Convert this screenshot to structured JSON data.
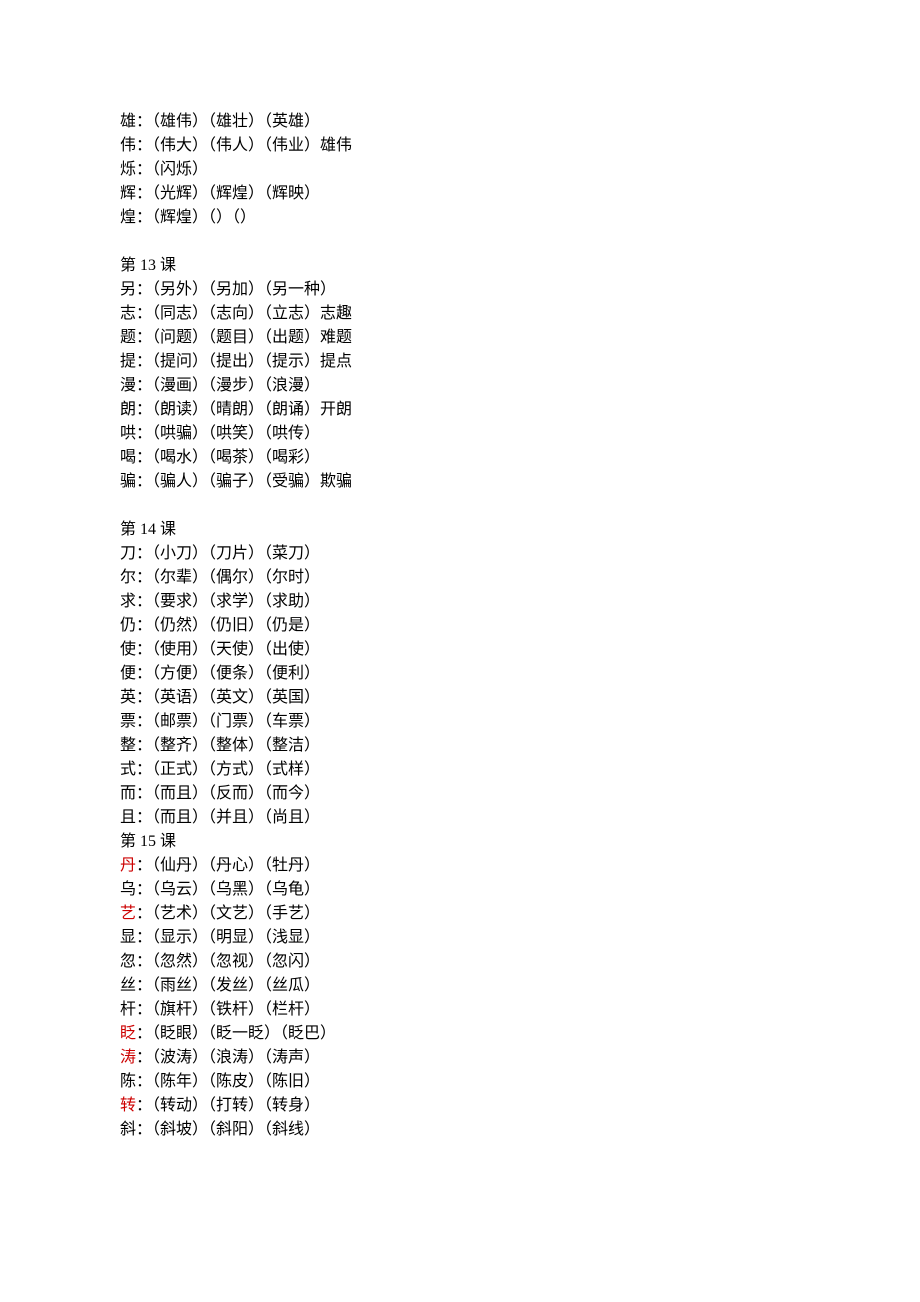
{
  "sections": [
    {
      "header": null,
      "entries": [
        {
          "char": "雄",
          "red": false,
          "words": "（雄伟）（雄壮）（英雄）",
          "extra": ""
        },
        {
          "char": "伟",
          "red": false,
          "words": "（伟大）（伟人）（伟业）",
          "extra": "雄伟"
        },
        {
          "char": "烁",
          "red": false,
          "words": "（闪烁）",
          "extra": ""
        },
        {
          "char": "辉",
          "red": false,
          "words": "（光辉）（辉煌）（辉映）",
          "extra": ""
        },
        {
          "char": "煌",
          "red": false,
          "words": "（辉煌）（）（）",
          "extra": ""
        }
      ]
    },
    {
      "header": "第 13 课",
      "entries": [
        {
          "char": "另",
          "red": false,
          "words": "（另外）（另加）（另一种）",
          "extra": ""
        },
        {
          "char": "志",
          "red": false,
          "words": "（同志）（志向）（立志）",
          "extra": "志趣"
        },
        {
          "char": "题",
          "red": false,
          "words": "（问题）（题目）（出题）",
          "extra": "难题"
        },
        {
          "char": "提",
          "red": false,
          "words": "（提问）（提出）（提示）",
          "extra": "提点"
        },
        {
          "char": "漫",
          "red": false,
          "words": "（漫画）（漫步）（浪漫）",
          "extra": ""
        },
        {
          "char": "朗",
          "red": false,
          "words": "（朗读）（晴朗）（朗诵）",
          "extra": "开朗"
        },
        {
          "char": "哄",
          "red": false,
          "words": "（哄骗）（哄笑）（哄传）",
          "extra": ""
        },
        {
          "char": "喝",
          "red": false,
          "words": "（喝水）（喝茶）（喝彩）",
          "extra": ""
        },
        {
          "char": "骗",
          "red": false,
          "words": "（骗人）（骗子）（受骗）",
          "extra": "欺骗"
        }
      ]
    },
    {
      "header": "第 14 课",
      "entries": [
        {
          "char": "刀",
          "red": false,
          "words": "（小刀）（刀片）（菜刀）",
          "extra": ""
        },
        {
          "char": "尔",
          "red": false,
          "words": "（尔辈）（偶尔）（尔时）",
          "extra": ""
        },
        {
          "char": "求",
          "red": false,
          "words": "（要求）（求学）（求助）",
          "extra": ""
        },
        {
          "char": "仍",
          "red": false,
          "words": "（仍然）（仍旧）（仍是）",
          "extra": ""
        },
        {
          "char": "使",
          "red": false,
          "words": "（使用）（天使）（出使）",
          "extra": ""
        },
        {
          "char": "便",
          "red": false,
          "words": "（方便）（便条）（便利）",
          "extra": ""
        },
        {
          "char": "英",
          "red": false,
          "words": "（英语）（英文）（英国）",
          "extra": ""
        },
        {
          "char": "票",
          "red": false,
          "words": "（邮票）（门票）（车票）",
          "extra": ""
        },
        {
          "char": "整",
          "red": false,
          "words": "（整齐）（整体）（整洁）",
          "extra": ""
        },
        {
          "char": "式",
          "red": false,
          "words": "（正式）（方式）（式样）",
          "extra": ""
        },
        {
          "char": "而",
          "red": false,
          "words": "（而且）（反而）（而今）",
          "extra": ""
        },
        {
          "char": "且",
          "red": false,
          "words": "（而且）（并且）（尚且）",
          "extra": ""
        }
      ]
    },
    {
      "header": "第 15 课",
      "tight": true,
      "entries": [
        {
          "char": "丹",
          "red": true,
          "words": "（仙丹）（丹心）（牡丹）",
          "extra": ""
        },
        {
          "char": "乌",
          "red": false,
          "words": "（乌云）（乌黑）（乌龟）",
          "extra": ""
        },
        {
          "char": "艺",
          "red": true,
          "words": "（艺术）（文艺）（手艺）",
          "extra": ""
        },
        {
          "char": "显",
          "red": false,
          "words": "（显示）（明显）（浅显）",
          "extra": ""
        },
        {
          "char": "忽",
          "red": false,
          "words": "（忽然）（忽视）（忽闪）",
          "extra": ""
        },
        {
          "char": "丝",
          "red": false,
          "words": "（雨丝）（发丝）（丝瓜）",
          "extra": ""
        },
        {
          "char": "杆",
          "red": false,
          "words": "（旗杆）（铁杆）（栏杆）",
          "extra": ""
        },
        {
          "char": "眨",
          "red": true,
          "words": "（眨眼）（眨一眨）（眨巴）",
          "extra": ""
        },
        {
          "char": "涛",
          "red": true,
          "words": "（波涛）（浪涛）（涛声）",
          "extra": ""
        },
        {
          "char": "陈",
          "red": false,
          "words": "（陈年）（陈皮）（陈旧）",
          "extra": ""
        },
        {
          "char": "转",
          "red": true,
          "words": "（转动）（打转）（转身）",
          "extra": ""
        },
        {
          "char": "斜",
          "red": false,
          "words": "（斜坡）（斜阳）（斜线）",
          "extra": ""
        }
      ]
    }
  ]
}
